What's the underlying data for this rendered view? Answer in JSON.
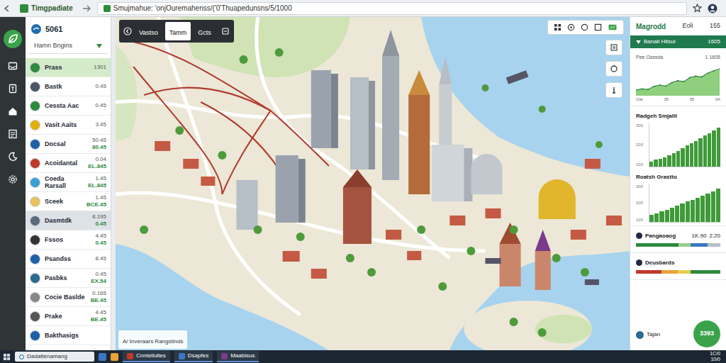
{
  "browser": {
    "tab": "Timgpadiate",
    "address": "Smujmahue: 'onjOuremahenss/('0'Thuapedunsns/5/1000"
  },
  "app": {
    "brand": "5061",
    "filter": "Hamn Bngins"
  },
  "list": [
    {
      "name": "Prass",
      "value": "1301",
      "selected": true,
      "highlighted": false,
      "color": "#2e8b3e"
    },
    {
      "name": "Bastk",
      "value": "0.45",
      "selected": false,
      "highlighted": false,
      "color": "#4b5563"
    },
    {
      "name": "Cessta Aac",
      "value": "0.45",
      "selected": false,
      "highlighted": false,
      "color": "#2e8b3e"
    },
    {
      "name": "Vasit Aaits",
      "value": "3.45",
      "selected": false,
      "highlighted": false,
      "color": "#e0b000"
    },
    {
      "name": "Docsal",
      "value": "50.45",
      "sub": "80.45",
      "selected": false,
      "highlighted": false,
      "color": "#1f5fa8"
    },
    {
      "name": "Acoidantal",
      "value": "0.04",
      "sub": "EL.845",
      "selected": false,
      "highlighted": false,
      "color": "#c0392b"
    },
    {
      "name": "Coeda Rarsall",
      "value": "1.45",
      "sub": "EL.845",
      "selected": false,
      "highlighted": false,
      "color": "#3aa0d8"
    },
    {
      "name": "Sceek",
      "value": "1.45",
      "sub": "BCE.45",
      "selected": false,
      "highlighted": false,
      "color": "#e6c35c"
    },
    {
      "name": "Dasmtdk",
      "value": "8.195",
      "sub": "0.45",
      "selected": false,
      "highlighted": true,
      "color": "#5b6b7a"
    },
    {
      "name": "Fssos",
      "value": "4.45",
      "sub": "0.45",
      "selected": false,
      "highlighted": false,
      "color": "#333333"
    },
    {
      "name": "Psandss",
      "value": "8.45",
      "selected": false,
      "highlighted": false,
      "color": "#1f5fa8"
    },
    {
      "name": "Pasbks",
      "value": "0.45",
      "sub": "EX.54",
      "selected": false,
      "highlighted": false,
      "color": "#2b6c8f"
    },
    {
      "name": "Cocie Baslde",
      "value": "0.165",
      "sub": "BE.45",
      "selected": false,
      "highlighted": false,
      "color": "#888888"
    },
    {
      "name": "Prake",
      "value": "4.45",
      "sub": "BE.45",
      "selected": false,
      "highlighted": false,
      "color": "#555555"
    },
    {
      "name": "Bakthasigs",
      "value": "",
      "selected": false,
      "highlighted": false,
      "color": "#1f5fa8"
    }
  ],
  "map": {
    "tabs": [
      {
        "label": "Vastso",
        "selected": false
      },
      {
        "label": "Tamm",
        "selected": true
      },
      {
        "label": "Gcts",
        "selected": false
      }
    ],
    "caption": "A/ Inveraars Rangstinds"
  },
  "panel": {
    "header": [
      "Magrodd",
      "Eoli",
      "155"
    ],
    "band": {
      "label": "Banail Hitsul",
      "value": "1605"
    },
    "area_chart": {
      "label": "Pee Gsssda",
      "value": "1 1605",
      "values": [
        18,
        22,
        20,
        30,
        34,
        31,
        42,
        48,
        45,
        58,
        63,
        60,
        72,
        80,
        86
      ],
      "x_ticks": [
        "Oat",
        "35",
        "35",
        "0A"
      ]
    },
    "bar_chart_1": {
      "title": "Radgeh Smjalit",
      "y_ticks": [
        "300",
        "200",
        "100"
      ],
      "values": [
        40,
        55,
        62,
        72,
        90,
        108,
        126,
        148,
        168,
        186,
        205,
        228,
        248,
        268,
        290,
        312
      ]
    },
    "bar_chart_2": {
      "title": "Roatsh Grastto",
      "y_ticks": [
        "300",
        "200",
        "100"
      ],
      "values": [
        60,
        78,
        95,
        112,
        130,
        150,
        168,
        188,
        202,
        222,
        240,
        262,
        282,
        305
      ]
    },
    "meter_1": {
      "label": "Pangaoaog",
      "value": "1K.90",
      "extra": "2.20",
      "segments": [
        {
          "level": 0.5,
          "color": "#2e8b3e"
        },
        {
          "level": 0.15,
          "color": "#9acd8a"
        },
        {
          "level": 0.2,
          "color": "#3b78c2"
        },
        {
          "level": 0.15,
          "color": "#b8bec4"
        }
      ]
    },
    "meter_2": {
      "label": "Deusbards",
      "segments": [
        {
          "level": 0.3,
          "color": "#c0392b"
        },
        {
          "level": 0.2,
          "color": "#e8a23a"
        },
        {
          "level": 0.15,
          "color": "#e6cf4a"
        },
        {
          "level": 0.35,
          "color": "#2e8b3e"
        }
      ]
    },
    "footer": {
      "label": "Tajan",
      "badge": "3393"
    }
  },
  "taskbar": {
    "search": "Dadattenamang",
    "apps": [
      "Cnntellutles",
      "Dsapfes",
      "Maabisus"
    ],
    "time": "1C/0",
    "date": "10/0"
  }
}
